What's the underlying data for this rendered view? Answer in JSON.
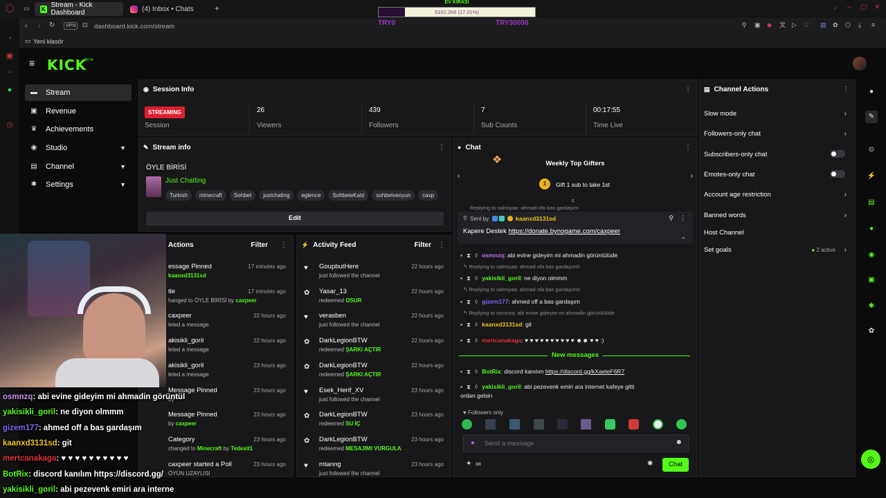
{
  "browser": {
    "tabs": [
      {
        "label": "Stream - Kick Dashboard",
        "active": true
      },
      {
        "label": "(4) Inbox • Chats",
        "active": false
      }
    ],
    "new_tab": "+",
    "vpn": "VPN",
    "url_domain": "dashboard.kick.com",
    "url_path": "/stream",
    "bookmark": "Yeni klasör"
  },
  "overlay_bar": {
    "top_label": "EV KİRASI",
    "value": "5102.266 (17.01%)",
    "progress": 0.17,
    "left_label": "TRY0",
    "right_label": "TRY30000"
  },
  "nav": {
    "logo": "KICK",
    "beta": "BETA",
    "items": [
      {
        "label": "Stream",
        "icon": "monitor-icon",
        "active": true,
        "chevron": false
      },
      {
        "label": "Revenue",
        "icon": "dollar-icon",
        "active": false,
        "chevron": false
      },
      {
        "label": "Achievements",
        "icon": "trophy-icon",
        "active": false,
        "chevron": false
      },
      {
        "label": "Studio",
        "icon": "studio-icon",
        "active": false,
        "chevron": true
      },
      {
        "label": "Channel",
        "icon": "channel-icon",
        "active": false,
        "chevron": true
      },
      {
        "label": "Settings",
        "icon": "gear-icon",
        "active": false,
        "chevron": true
      }
    ]
  },
  "session": {
    "title": "Session Info",
    "status": "STREAMING",
    "status_label": "Session",
    "stats": [
      {
        "value": "26",
        "label": "Viewers"
      },
      {
        "value": "439",
        "label": "Followers"
      },
      {
        "value": "7",
        "label": "Sub Counts"
      },
      {
        "value": "00:17:55",
        "label": "Time Live"
      }
    ]
  },
  "stream_info": {
    "title": "Stream info",
    "stream_title": "ÖYLE BİRİSİ",
    "category": "Just Chatting",
    "tags": [
      "Turkish",
      "minecraft",
      "Sohbet",
      "justchating",
      "eglence",
      "SohbeteKatıl",
      "sohbetveoyun",
      "caxp"
    ],
    "edit_label": "Edit"
  },
  "mod_actions": {
    "title": "Actions",
    "filter": "Filter",
    "rows": [
      {
        "name": "essage Pinned",
        "sub": "kaanxd3131sd",
        "sub_prefix": "",
        "time": "17 minutes ago"
      },
      {
        "name": "tle",
        "sub": "ÖYLE BİRİSİ",
        "sub_prefix": "hanged to",
        "sub_suffix": "by",
        "sub_user": "caxpeer",
        "time": "17 minutes ago"
      },
      {
        "name": "caxpeer",
        "sub": "leted a message",
        "time": "22 hours ago"
      },
      {
        "name": "akisikli_goril",
        "sub": "leted a message",
        "time": "22 hours ago"
      },
      {
        "name": "akisikli_goril",
        "sub": "leted a message",
        "time": "23 hours ago"
      },
      {
        "name": "Message Pinned",
        "sub": "by",
        "sub_user": "",
        "time": "23 hours ago"
      },
      {
        "name": "Message Pinned",
        "sub": "by",
        "sub_user": "caxpeer",
        "time": "23 hours ago"
      },
      {
        "name": "Category",
        "sub": "changed to",
        "sub_green": "Minecraft",
        "sub_suffix": "by",
        "sub_user": "Tedexit1",
        "time": "23 hours ago"
      },
      {
        "name": "caxpeer started a Poll",
        "sub": "ÖYÜN UZAYLISI",
        "time": "23 hours ago"
      }
    ]
  },
  "activity": {
    "title": "Activity Feed",
    "filter": "Filter",
    "rows": [
      {
        "icon": "heart-icon",
        "name": "GoupbutHere",
        "sub": "just followed the channel",
        "reward": "",
        "time": "22 hours ago"
      },
      {
        "icon": "reward-icon",
        "name": "Yasar_13",
        "sub": "redeemed",
        "reward": "OSUR",
        "time": "22 hours ago"
      },
      {
        "icon": "heart-icon",
        "name": "verasben",
        "sub": "just followed the channel",
        "reward": "",
        "time": "22 hours ago"
      },
      {
        "icon": "reward-icon",
        "name": "DarkLegionBTW",
        "sub": "redeemed",
        "reward": "ŞARKI AÇTIR",
        "time": "22 hours ago"
      },
      {
        "icon": "reward-icon",
        "name": "DarkLegionBTW",
        "sub": "redeemed",
        "reward": "ŞARKI AÇTIR",
        "time": "22 hours ago"
      },
      {
        "icon": "heart-icon",
        "name": "Esek_Herif_XV",
        "sub": "just followed the channel",
        "reward": "",
        "time": "23 hours ago"
      },
      {
        "icon": "reward-icon",
        "name": "DarkLegionBTW",
        "sub": "redeemed",
        "reward": "SU İÇ",
        "time": "23 hours ago"
      },
      {
        "icon": "reward-icon",
        "name": "DarkLegionBTW",
        "sub": "redeemed",
        "reward": "MESAJIMI VURGULA",
        "time": "23 hours ago"
      },
      {
        "icon": "heart-icon",
        "name": "mtanng",
        "sub": "just followed the channel",
        "reward": "",
        "time": "23 hours ago"
      }
    ]
  },
  "chat": {
    "title": "Chat",
    "gifters_title": "Weekly Top Gifters",
    "gifters_text": "Gift 1 sub to take 1st",
    "gifters_badge": "1",
    "pinned_top": "Replying to salmiyaa: ahmad ofa bas gardaşım",
    "pinned_sent_by": "Sent by",
    "pinned_user": "kaanxd3131sd",
    "pinned_msg_prefix": "Kapere Destek",
    "pinned_link": "https://donate.bynogame.com/caxpeer",
    "messages": [
      {
        "reply": "",
        "user": "osmnzq",
        "color": "u-purple",
        "text": ": abi evine gideyim mi ahmadin görüntülüde"
      },
      {
        "reply": "Replying to salmiyaa: ahmad ofa bas gardaşımh",
        "user": "yakisikli_goril",
        "color": "u-green",
        "text": ": ne diyon olmmm"
      },
      {
        "reply": "Replying to salmiyaa: ahmad ofa bas gardaşımh",
        "user": "gizem177",
        "color": "u-violet",
        "text": ": ahmed off a bas gardaşım"
      },
      {
        "reply": "Replying to osmnzq: abi evine gideyim mi ahmadin görüntülüde",
        "user": "kaanxd3131sd",
        "color": "u-yellow",
        "text": ": git"
      },
      {
        "reply": "",
        "user": "mertcanakaga",
        "color": "u-red",
        "text": ": ♥ ♥ ♥ ♥ ♥ ♥ ♥ ♥ ♥ ♥ ☻☻ ♥ ♥ :)"
      }
    ],
    "new_messages": "New messages",
    "after": [
      {
        "user": "BotRix",
        "color": "u-green",
        "text": ": discord kanılım ",
        "link": "https://discord.gg/kXaeteF6R7"
      },
      {
        "user": "yakisikli_goril",
        "color": "u-green",
        "text": ": abi pezevenk emiri ara internet kafeye gitti",
        "text2": "ordan gelsin"
      }
    ],
    "followers_only": "Followers only",
    "input_placeholder": "Send a message",
    "chat_button": "Chat",
    "infinity": "∞"
  },
  "channel_actions": {
    "title": "Channel Actions",
    "items": [
      {
        "label": "Slow mode",
        "type": "chevron"
      },
      {
        "label": "Followers-only chat",
        "type": "chevron"
      },
      {
        "label": "Subscribers-only chat",
        "type": "toggle"
      },
      {
        "label": "Emotes-only chat",
        "type": "toggle"
      },
      {
        "label": "Account age restriction",
        "type": "chevron"
      },
      {
        "label": "Banned words",
        "type": "chevron"
      },
      {
        "label": "Host Channel",
        "type": "none"
      },
      {
        "label": "Set goals",
        "type": "chevron",
        "extra": "2 active"
      }
    ]
  },
  "overlay_chat": [
    {
      "user": "osmnzq",
      "text": ": abi evine gideyim mi ahmadin görüntül",
      "color": "#c890f5"
    },
    {
      "user": "yakisikli_goril",
      "text": ": ne diyon olmmm",
      "color": "#53fc18"
    },
    {
      "user": "gizem177",
      "text": ": ahmed off a bas gardaşım",
      "color": "#7c6cf0"
    },
    {
      "user": "kaanxd3131sd",
      "text": ": git",
      "color": "#f0c419"
    },
    {
      "user": "mertcanakaga",
      "text": ": ♥ ♥ ♥ ♥ ♥ ♥ ♥ ♥ ♥ ♥",
      "color": "#e0303a"
    },
    {
      "user": "BotRix",
      "text": ": discord kanılım https://discord.gg/",
      "color": "#53fc18"
    },
    {
      "user": "yakisikli_goril",
      "text": ": abi pezevenk emiri ara interne",
      "color": "#53fc18"
    }
  ],
  "colors": {
    "accent": "#53fc18",
    "live": "#e0202e",
    "panel": "#18181a"
  }
}
